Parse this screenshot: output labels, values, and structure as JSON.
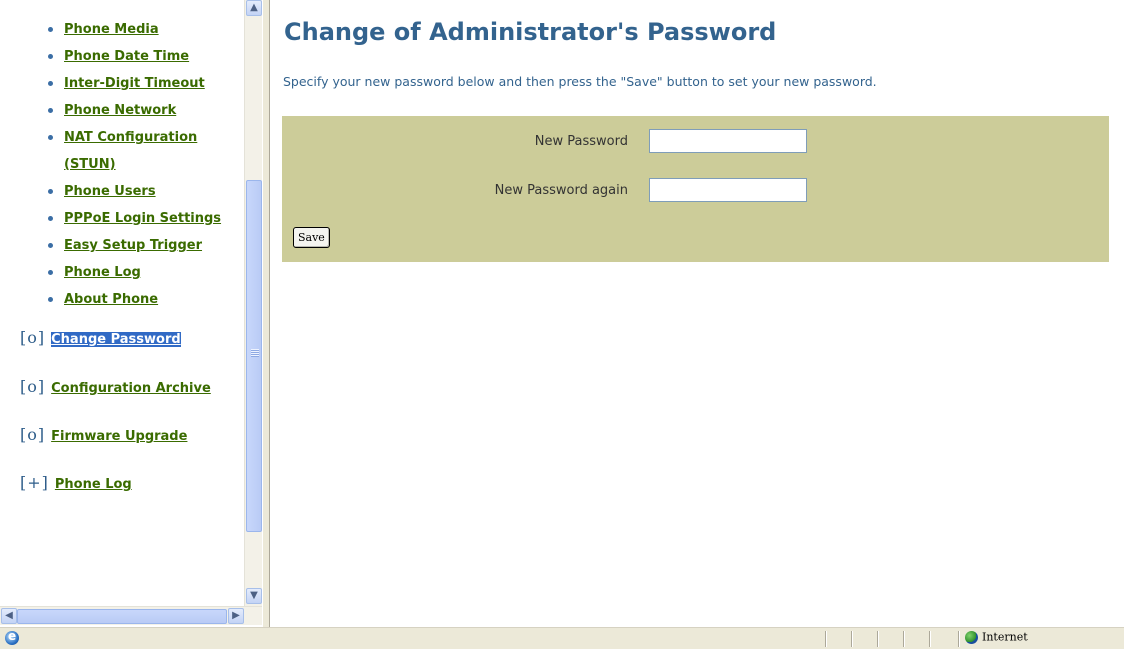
{
  "nav": {
    "items": [
      {
        "label": "Phone Media"
      },
      {
        "label": "Phone Date Time"
      },
      {
        "label": "Inter-Digit Timeout"
      },
      {
        "label": "Phone Network"
      },
      {
        "label": "NAT Configuration (STUN)"
      },
      {
        "label": "Phone Users"
      },
      {
        "label": "PPPoE Login Settings"
      },
      {
        "label": "Easy Setup Trigger"
      },
      {
        "label": "Phone Log"
      },
      {
        "label": "About Phone"
      }
    ],
    "sections": [
      {
        "marker": "[o]",
        "label": "Change Password",
        "selected": true
      },
      {
        "marker": "[o]",
        "label": "Configuration Archive"
      },
      {
        "marker": "[o]",
        "label": "Firmware Upgrade"
      },
      {
        "marker": "[+]",
        "label": "Phone Log"
      }
    ]
  },
  "main": {
    "title": "Change of Administrator's Password",
    "description": "Specify your new password below and then press the \"Save\" button to set your new password.",
    "form": {
      "new_password_label": "New Password",
      "new_password_value": "",
      "new_password_again_label": "New Password again",
      "new_password_again_value": "",
      "save_label": "Save"
    }
  },
  "status_bar": {
    "zone_label": "Internet"
  },
  "colors": {
    "title": "#33638e",
    "link": "#3a6b00",
    "form_background": "#cccc99",
    "selected_link_bg": "#316ac5"
  }
}
